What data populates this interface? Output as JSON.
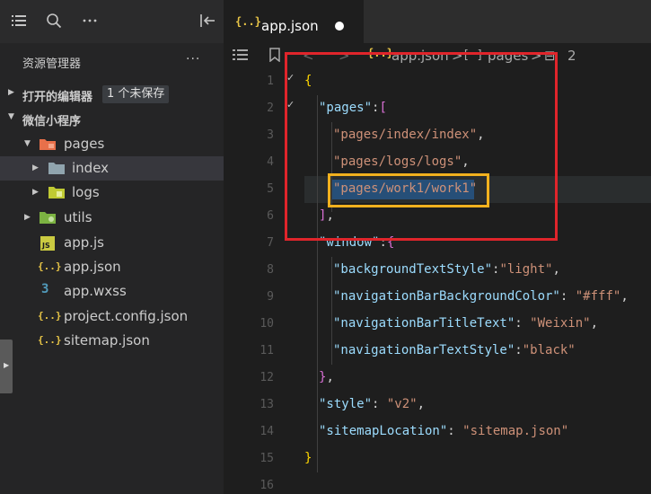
{
  "activity_icons": [
    "list-icon",
    "search-icon",
    "more-icon",
    "collapse-panel-icon"
  ],
  "explorer": {
    "title": "资源管理器",
    "more": "···"
  },
  "open_editors": {
    "label": "打开的编辑器",
    "badge": "1 个未保存"
  },
  "project": {
    "label": "微信小程序"
  },
  "tree": [
    {
      "name": "pages",
      "icon": "folder-pages-icon"
    },
    {
      "name": "index",
      "icon": "folder-icon"
    },
    {
      "name": "logs",
      "icon": "folder-logs-icon"
    },
    {
      "name": "utils",
      "icon": "folder-utils-icon"
    },
    {
      "name": "app.js",
      "icon": "js-file-icon",
      "icon_text": "JS"
    },
    {
      "name": "app.json",
      "icon": "json-file-icon",
      "icon_text": "{..}"
    },
    {
      "name": "app.wxss",
      "icon": "css-file-icon",
      "icon_text": "3"
    },
    {
      "name": "project.config.json",
      "icon": "json-file-icon",
      "icon_text": "{..}"
    },
    {
      "name": "sitemap.json",
      "icon": "json-file-icon",
      "icon_text": "{..}"
    }
  ],
  "tab": {
    "icon_text": "{..}",
    "title": "app.json"
  },
  "breadcrumb": {
    "file": "app.json",
    "key_icon": "[ ]",
    "key": "pages",
    "index_icon": "⊟",
    "index": "2"
  },
  "line_numbers": [
    "1",
    "2",
    "3",
    "4",
    "5",
    "6",
    "7",
    "8",
    "9",
    "10",
    "11",
    "12",
    "13",
    "14",
    "15",
    "16"
  ],
  "code": {
    "l1_open": "{",
    "pages_key": "\"pages\"",
    "colon": ":",
    "bracket_open": "[",
    "page1": "\"pages/index/index\"",
    "page2": "\"pages/logs/logs\"",
    "page3": "\"pages/work1/work1\"",
    "comma": ",",
    "bracket_close": "]",
    "window_key": "\"window\"",
    "brace_open": "{",
    "bts_key": "\"backgroundTextStyle\"",
    "bts_val": "\"light\"",
    "nbbc_key": "\"navigationBarBackgroundColor\"",
    "nbbc_val": "\"#fff\"",
    "nbtt_key": "\"navigationBarTitleText\"",
    "nbtt_val": "\"Weixin\"",
    "nbts_key": "\"navigationBarTextStyle\"",
    "nbts_val": "\"black\"",
    "brace_close": "}",
    "style_key": "\"style\"",
    "style_val": "\"v2\"",
    "sitemap_key": "\"sitemapLocation\"",
    "sitemap_val": "\"sitemap.json\"",
    "l15_close": "}"
  },
  "colors": {
    "highlight_red": "#e0252b",
    "highlight_yellow": "#f2b11e",
    "selection": "#264f78"
  }
}
